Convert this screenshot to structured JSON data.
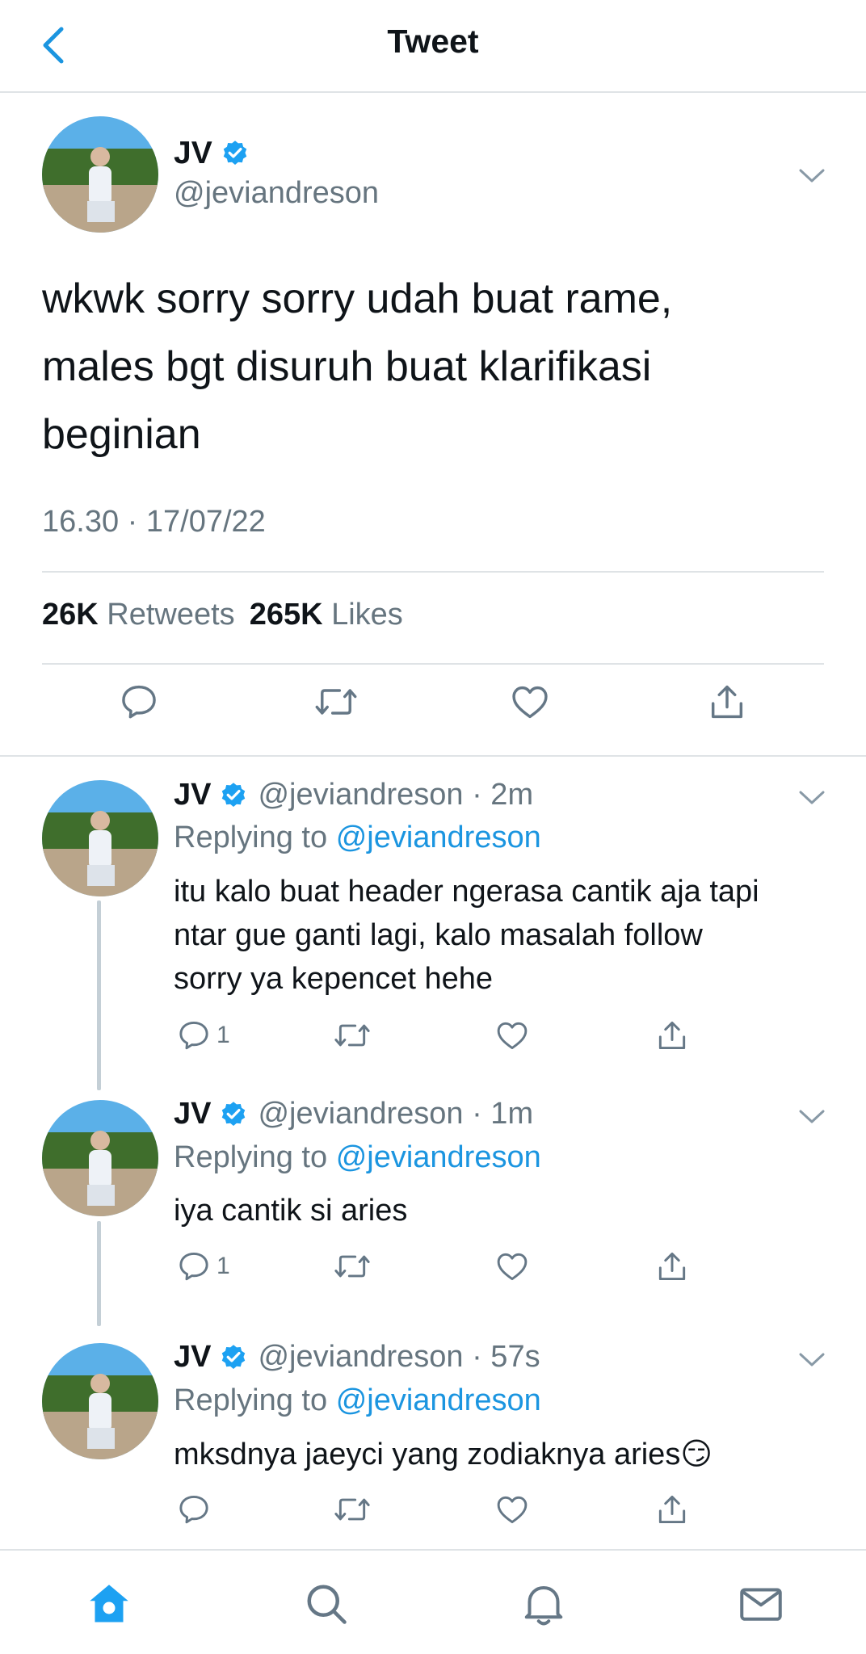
{
  "header": {
    "title": "Tweet"
  },
  "main_tweet": {
    "name": "JV",
    "handle": "@jeviandreson",
    "text_lines": [
      "wkwk sorry sorry udah buat rame,",
      "males bgt disuruh buat klarifikasi",
      "beginian"
    ],
    "timestamp": "16.30 · 17/07/22",
    "retweets_count": "26K",
    "retweets_label": "Retweets",
    "likes_count": "265K",
    "likes_label": "Likes"
  },
  "replies": [
    {
      "name": "JV",
      "handle_time": "@jeviandreson · 2m",
      "replying_prefix": "Replying to",
      "replying_to": "@jeviandreson",
      "text_lines": [
        "itu kalo buat header ngerasa cantik aja tapi",
        "ntar gue ganti lagi, kalo masalah follow",
        "sorry ya kepencet hehe"
      ],
      "reply_count": "1"
    },
    {
      "name": "JV",
      "handle_time": "@jeviandreson · 1m",
      "replying_prefix": "Replying to",
      "replying_to": "@jeviandreson",
      "text_lines": [
        "iya cantik si aries"
      ],
      "reply_count": "1"
    },
    {
      "name": "JV",
      "handle_time": "@jeviandreson · 57s",
      "replying_prefix": "Replying to",
      "replying_to": "@jeviandreson",
      "text_lines": [
        "mksdnya jaeyci yang zodiaknya aries😏"
      ],
      "reply_count": ""
    }
  ],
  "tabbar": [
    "home-icon",
    "search-icon",
    "bell-icon",
    "mail-icon"
  ],
  "colors": {
    "accent": "#1b95e0",
    "secondary_text": "#66757f",
    "divider": "#dfe3e6"
  }
}
